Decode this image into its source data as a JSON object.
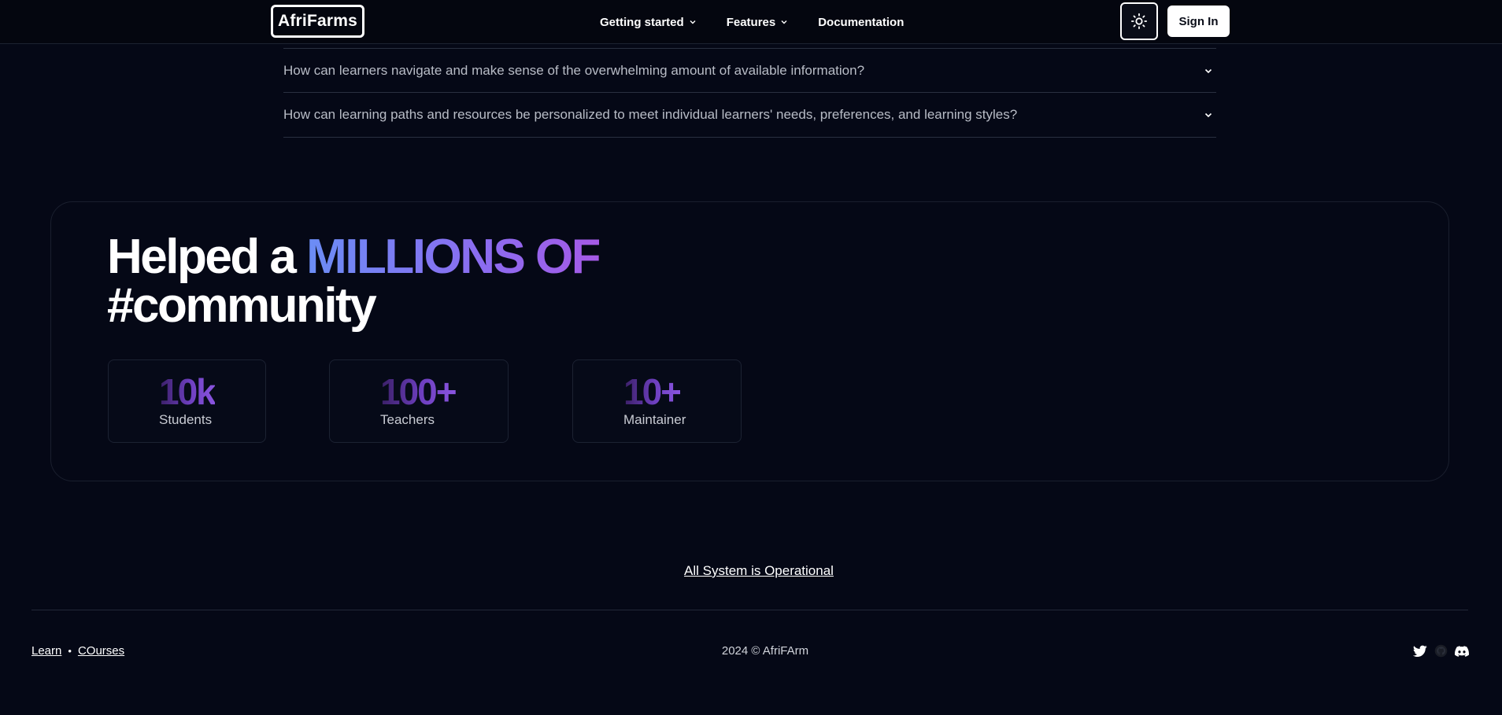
{
  "header": {
    "logo": "AfriFarms",
    "nav": [
      {
        "label": "Getting started",
        "has_dropdown": true
      },
      {
        "label": "Features",
        "has_dropdown": true
      },
      {
        "label": "Documentation",
        "has_dropdown": false
      }
    ],
    "theme_icon": "sun-icon",
    "signin_label": "Sign In"
  },
  "faq": {
    "items": [
      {
        "question": "How can learners navigate and make sense of the overwhelming amount of available information?"
      },
      {
        "question": "How can learning paths and resources be personalized to meet individual learners' needs, preferences, and learning styles?"
      }
    ]
  },
  "community": {
    "headline_prefix": "Helped a ",
    "headline_highlight": "MILLIONS OF",
    "headline_suffix": "#community",
    "stats": [
      {
        "value": "10k",
        "label": "Students"
      },
      {
        "value": "100+",
        "label": "Teachers"
      },
      {
        "value": "10+",
        "label": "Maintainer"
      }
    ]
  },
  "status": {
    "label": "All System is Operational"
  },
  "footer": {
    "links": [
      "Learn",
      "COurses"
    ],
    "separator": "•",
    "copyright": "2024 © AfriFArm",
    "social_icons": [
      "twitter-icon",
      "github-icon",
      "discord-icon"
    ]
  },
  "colors": {
    "background": "#050816",
    "gradient_start": "#6b8df5",
    "gradient_end": "#a55ae6",
    "stat_gradient": "#6d3fbf"
  }
}
